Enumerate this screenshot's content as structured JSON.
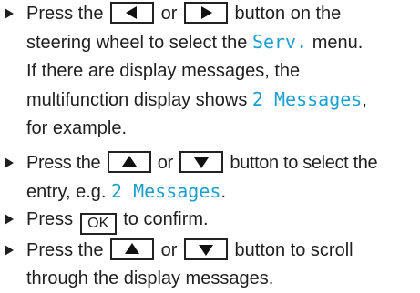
{
  "colors": {
    "display_text": "#1a9fd0",
    "text": "#1f1f1f",
    "key_border": "#222222"
  },
  "steps": [
    {
      "bullet_icon": "right-triangle-bullet",
      "lines": [
        {
          "a": "Press the",
          "b": "or",
          "c": "button on the"
        },
        {
          "a": "steering wheel to select the",
          "menu": "Serv.",
          "b": "menu."
        },
        {
          "a": "If there are display messages, the"
        },
        {
          "a": "multifunction display shows",
          "msg": "2 Messages",
          "b": ","
        },
        {
          "a": "for example."
        }
      ],
      "keys": [
        "left-arrow-key",
        "right-arrow-key"
      ]
    },
    {
      "bullet_icon": "right-triangle-bullet",
      "lines": [
        {
          "a": "Press the",
          "b": "or",
          "c": "button to select the"
        },
        {
          "a": "entry, e.g.",
          "msg": "2 Messages",
          "b": "."
        }
      ],
      "keys": [
        "up-arrow-key",
        "down-arrow-key"
      ]
    },
    {
      "bullet_icon": "right-triangle-bullet",
      "lines": [
        {
          "a": "Press",
          "key": "OK",
          "b": "to confirm."
        }
      ]
    },
    {
      "bullet_icon": "right-triangle-bullet",
      "lines": [
        {
          "a": "Press the",
          "b": "or",
          "c": "button to scroll"
        },
        {
          "a": "through the display messages."
        }
      ],
      "keys": [
        "up-arrow-key",
        "down-arrow-key"
      ]
    }
  ]
}
